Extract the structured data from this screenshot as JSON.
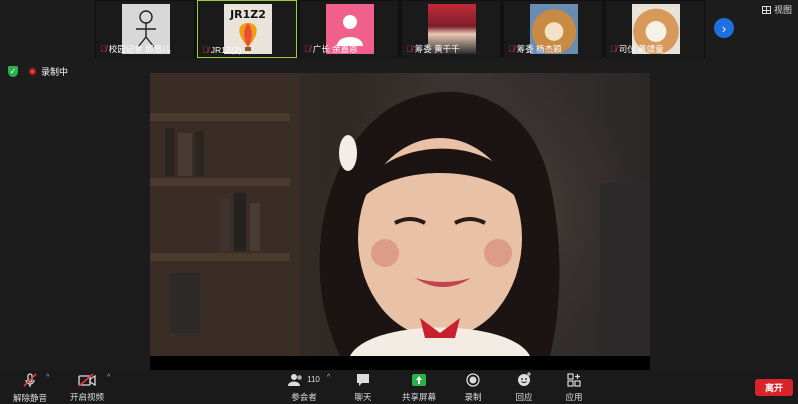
{
  "participants": [
    {
      "name": "校园记者 邱悠儿",
      "muted": true,
      "thumb": "stick-figure"
    },
    {
      "name": "JR1Z(2)",
      "muted": true,
      "thumb": "jr1z-logo",
      "logo_text": "JR1Z2",
      "active": true
    },
    {
      "name": "广长 余嘉恩",
      "muted": true,
      "thumb": "default-avatar",
      "color": "#f0608a"
    },
    {
      "name": "筹委 黄千千",
      "muted": true,
      "thumb": "red-hair-photo"
    },
    {
      "name": "筹委 杨杰颖",
      "muted": true,
      "thumb": "shiba-dog-photo"
    },
    {
      "name": "司仪 黄靖童",
      "muted": true,
      "thumb": "cat-photo"
    }
  ],
  "top": {
    "view_label": "视图"
  },
  "status": {
    "recording_label": "录制中"
  },
  "toolbar": {
    "unmute": "解除静音",
    "start_video": "开启视频",
    "participants": "参会者",
    "participant_count": "110",
    "chat": "聊天",
    "share_screen": "共享屏幕",
    "record": "录制",
    "reactions": "回应",
    "apps": "应用",
    "leave": "离开"
  },
  "colors": {
    "accent": "#1e6fe0",
    "share_green": "#29b14a",
    "leave_red": "#d9232a",
    "mute_red": "#e23b3b",
    "active_border": "#9acd32"
  }
}
